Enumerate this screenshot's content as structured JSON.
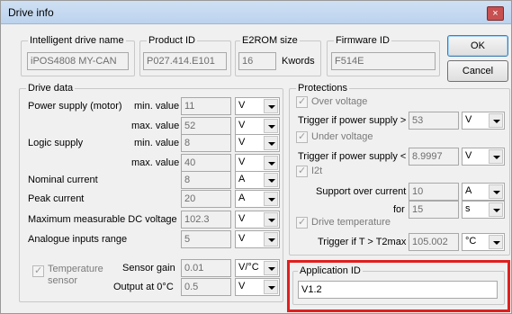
{
  "window": {
    "title": "Drive info",
    "close_glyph": "×"
  },
  "identity": {
    "drive_name": {
      "label": "Intelligent drive name",
      "value": "iPOS4808 MY-CAN"
    },
    "product_id": {
      "label": "Product ID",
      "value": "P027.414.E101"
    },
    "e2rom": {
      "label": "E2ROM size",
      "value": "16",
      "unit": "Kwords"
    },
    "firmware": {
      "label": "Firmware ID",
      "value": "F514E"
    }
  },
  "buttons": {
    "ok": "OK",
    "cancel": "Cancel"
  },
  "drive_data": {
    "title": "Drive data",
    "power_supply": {
      "label": "Power supply (motor)",
      "min_label": "min. value",
      "min": "11",
      "min_unit": "V",
      "max_label": "max. value",
      "max": "52",
      "max_unit": "V"
    },
    "logic_supply": {
      "label": "Logic supply",
      "min_label": "min. value",
      "min": "8",
      "min_unit": "V",
      "max_label": "max. value",
      "max": "40",
      "max_unit": "V"
    },
    "nominal_current": {
      "label": "Nominal current",
      "value": "8",
      "unit": "A"
    },
    "peak_current": {
      "label": "Peak current",
      "value": "20",
      "unit": "A"
    },
    "max_dc_voltage": {
      "label": "Maximum measurable DC voltage",
      "value": "102.3",
      "unit": "V"
    },
    "analogue_range": {
      "label": "Analogue inputs range",
      "value": "5",
      "unit": "V"
    },
    "temp_sensor": {
      "label": "Temperature sensor",
      "label_line1": "Temperature",
      "label_line2": "sensor"
    },
    "sensor_gain": {
      "label": "Sensor gain",
      "value": "0.01",
      "unit": "V/°C"
    },
    "output_at_0c": {
      "label": "Output at 0°C",
      "value": "0.5",
      "unit": "V"
    }
  },
  "protections": {
    "title": "Protections",
    "over_voltage": {
      "label": "Over voltage",
      "trigger_label": "Trigger if power supply >",
      "value": "53",
      "unit": "V"
    },
    "under_voltage": {
      "label": "Under voltage",
      "trigger_label": "Trigger if power supply <",
      "value": "8.9997",
      "unit": "V"
    },
    "i2t": {
      "label": "I2t",
      "support_label": "Support over current",
      "support_value": "10",
      "support_unit": "A",
      "for_label": "for",
      "for_value": "15",
      "for_unit": "s"
    },
    "drive_temperature": {
      "label": "Drive temperature",
      "trigger_label": "Trigger if T > T2max",
      "value": "105.002",
      "unit": "°C"
    }
  },
  "application": {
    "label": "Application ID",
    "value": "V1.2"
  },
  "colors": {
    "highlight": "#e0201e"
  }
}
